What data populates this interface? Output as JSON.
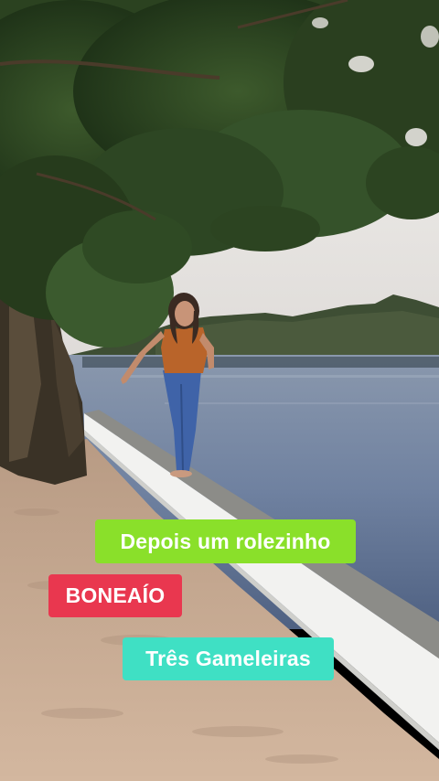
{
  "captions": [
    {
      "text": "Depois um rolezinho",
      "background": "#8ae02a"
    },
    {
      "text": "BONEAÍO",
      "background": "#e9374f"
    },
    {
      "text": "Três Gameleiras",
      "background": "#3fe0c4"
    }
  ],
  "colors": {
    "sky": "#e9e6e2",
    "water": "#6d7e99",
    "sand": "#c9ab92",
    "wall": "#f1f1ef",
    "foliage": "#2f4a22"
  }
}
